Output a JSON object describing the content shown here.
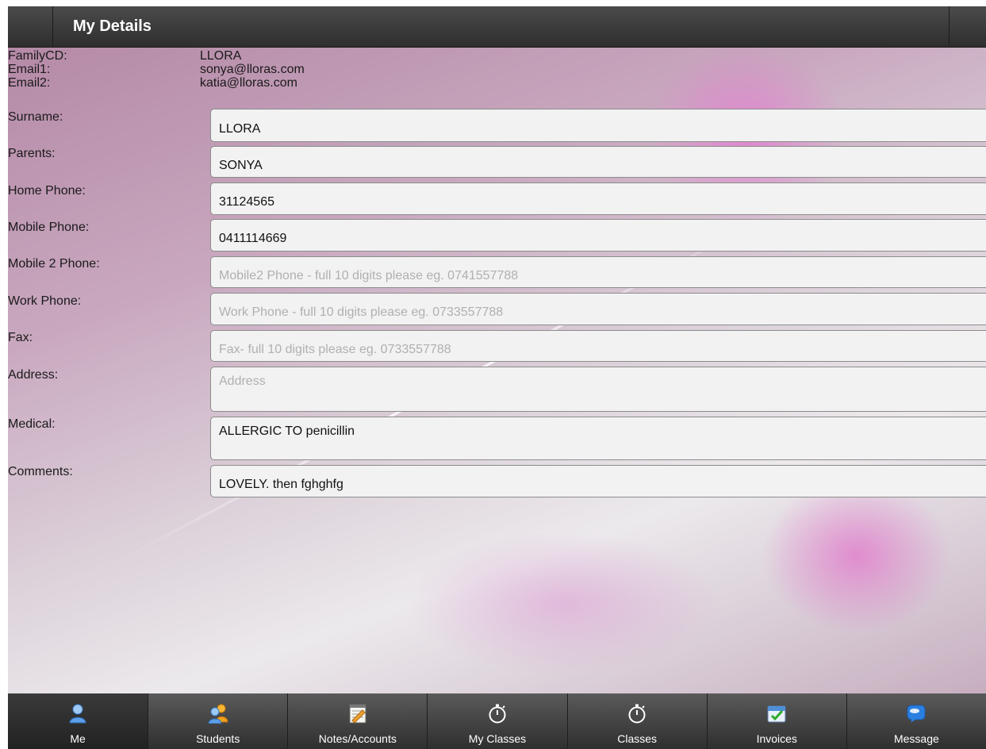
{
  "header": {
    "title": "My Details"
  },
  "info": {
    "family_cd_label": "FamilyCD:",
    "family_cd_value": "LLORA",
    "email1_label": "Email1:",
    "email1_value": "sonya@lloras.com",
    "email2_label": "Email2:",
    "email2_value": "katia@lloras.com"
  },
  "form": {
    "surname": {
      "label": "Surname:",
      "value": "LLORA",
      "placeholder": ""
    },
    "parents": {
      "label": "Parents:",
      "value": "SONYA",
      "placeholder": ""
    },
    "home_phone": {
      "label": "Home Phone:",
      "value": "31124565",
      "placeholder": ""
    },
    "mobile_phone": {
      "label": "Mobile Phone:",
      "value": "0411114669",
      "placeholder": ""
    },
    "mobile2_phone": {
      "label": "Mobile 2 Phone:",
      "value": "",
      "placeholder": "Mobile2 Phone - full 10 digits please eg. 0741557788"
    },
    "work_phone": {
      "label": "Work Phone:",
      "value": "",
      "placeholder": "Work Phone - full 10 digits please eg. 0733557788"
    },
    "fax": {
      "label": "Fax:",
      "value": "",
      "placeholder": "Fax- full 10 digits please eg. 0733557788"
    },
    "address": {
      "label": "Address:",
      "value": "",
      "placeholder": "Address"
    },
    "medical": {
      "label": "Medical:",
      "value": "ALLERGIC TO penicillin",
      "placeholder": ""
    },
    "comments": {
      "label": "Comments:",
      "value": "LOVELY. then fghghfg",
      "placeholder": ""
    }
  },
  "tabs": [
    {
      "label": "Me",
      "icon": "person-icon",
      "active": true
    },
    {
      "label": "Students",
      "icon": "group-icon",
      "active": false
    },
    {
      "label": "Notes/Accounts",
      "icon": "notepad-icon",
      "active": false
    },
    {
      "label": "My Classes",
      "icon": "stopwatch-icon",
      "active": false
    },
    {
      "label": "Classes",
      "icon": "stopwatch-icon",
      "active": false
    },
    {
      "label": "Invoices",
      "icon": "calendar-check-icon",
      "active": false
    },
    {
      "label": "Message",
      "icon": "chat-bubble-icon",
      "active": false
    }
  ]
}
